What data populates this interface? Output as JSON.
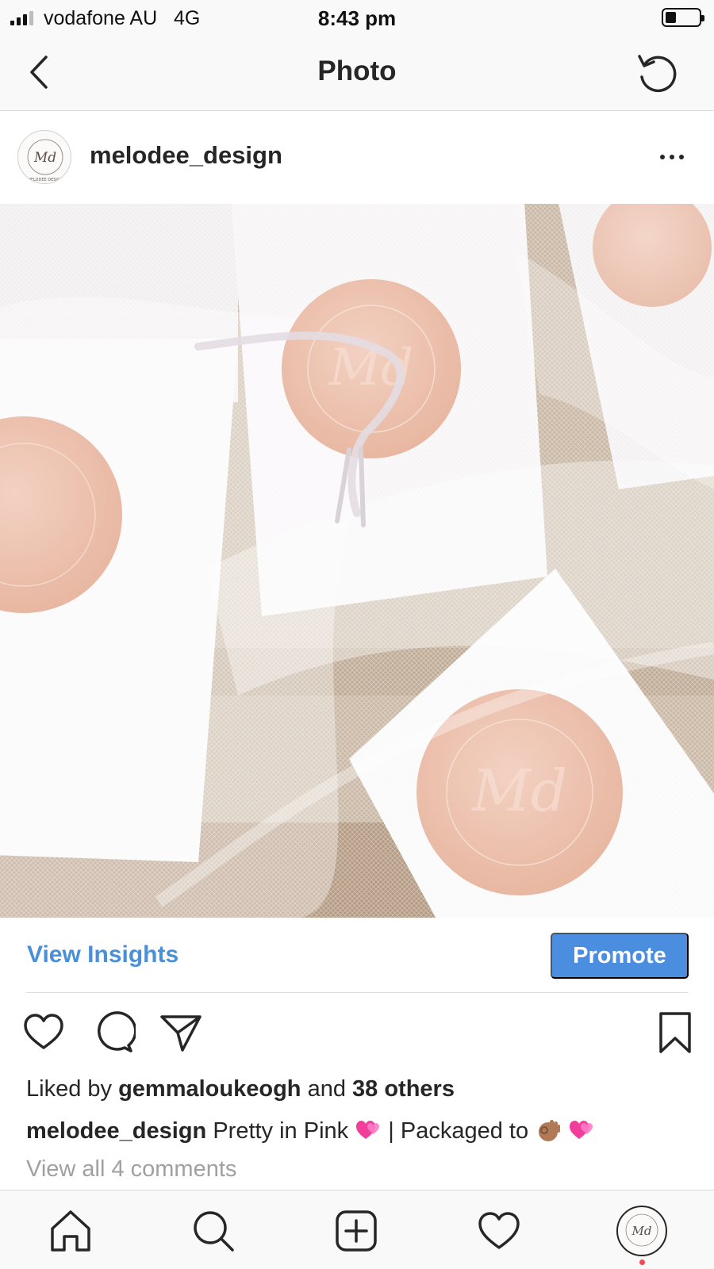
{
  "status_bar": {
    "carrier": "vodafone AU",
    "network": "4G",
    "time": "8:43 pm",
    "battery_level": 0.3
  },
  "header": {
    "title": "Photo",
    "back_icon": "chevron-left-icon",
    "refresh_icon": "rotate-ccw-icon"
  },
  "post": {
    "username": "melodee_design",
    "avatar_monogram": "Md",
    "avatar_ring_text": "MELODEE DESIGN",
    "more_icon": "more-horizontal-icon",
    "photo_description_icon": "photo-image"
  },
  "insights": {
    "view_insights_label": "View Insights",
    "promote_label": "Promote",
    "promote_color": "#4b8ee0",
    "link_color": "#4a90d9"
  },
  "actions": {
    "like_icon": "heart-icon",
    "comment_icon": "comment-icon",
    "share_icon": "send-icon",
    "save_icon": "bookmark-icon"
  },
  "likes": {
    "prefix": "Liked by",
    "user": "gemmaloukeogh",
    "joiner": "and",
    "others": "38 others"
  },
  "caption": {
    "username": "melodee_design",
    "text_part1": "Pretty in Pink",
    "text_part2": "| Packaged to"
  },
  "comments": {
    "link": "View all 4 comments"
  },
  "tabbar": {
    "home_icon": "home-icon",
    "search_icon": "search-icon",
    "new_post_icon": "plus-square-icon",
    "activity_icon": "heart-icon",
    "profile_icon": "avatar",
    "notification_dot_color": "#ed4956"
  }
}
